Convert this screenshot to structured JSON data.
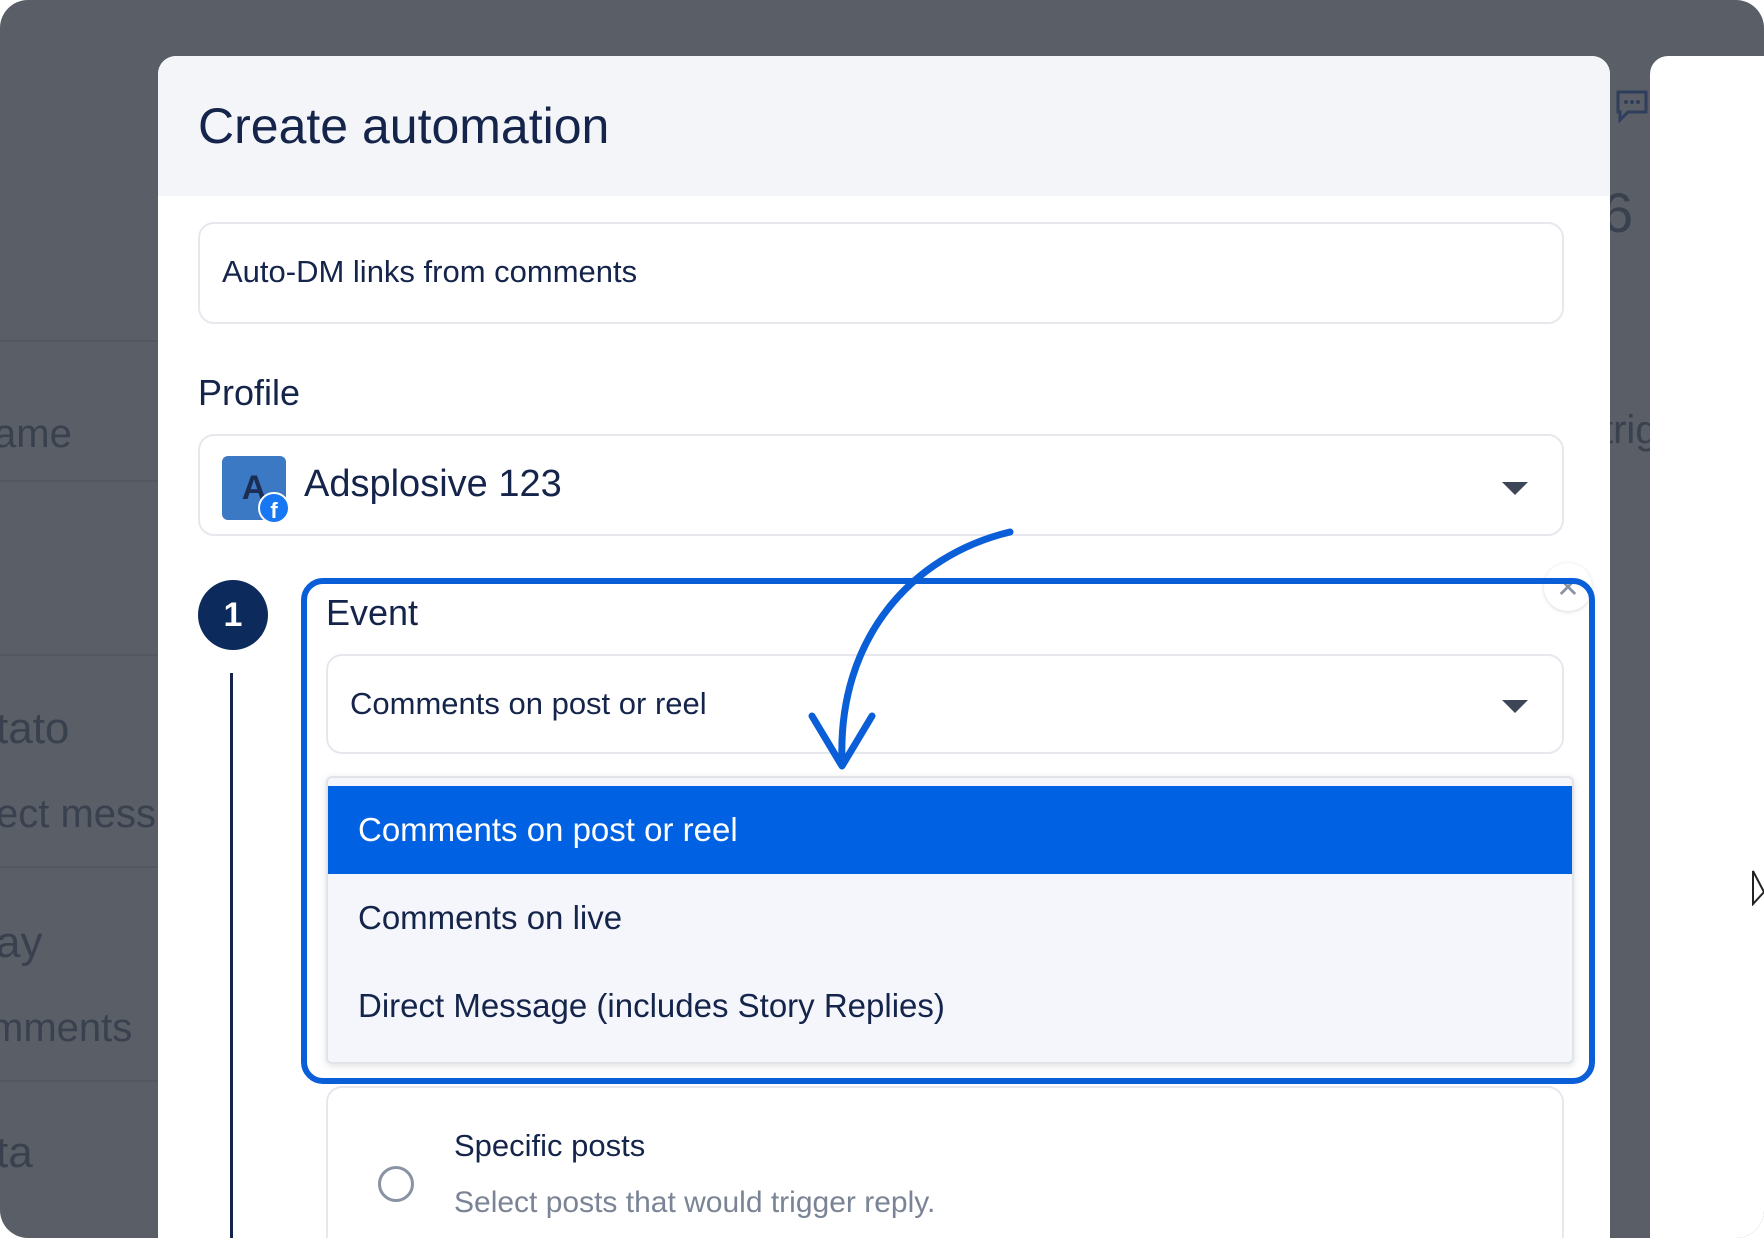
{
  "background": {
    "fragments": [
      "ame",
      "tato",
      "ect mess",
      "ay",
      "mments",
      "ta"
    ],
    "right_fragments": [
      "6",
      "trig"
    ]
  },
  "modal": {
    "title": "Create automation",
    "name_field": {
      "value": "Auto-DM links from comments"
    },
    "profile": {
      "label": "Profile",
      "value": "Adsplosive 123",
      "avatar_letter": "A",
      "badge_letter": "f"
    },
    "step": {
      "number": "1",
      "event": {
        "label": "Event",
        "selected": "Comments on post or reel",
        "options": [
          "Comments on post or reel",
          "Comments on live",
          "Direct Message (includes Story Replies)"
        ]
      }
    },
    "posts_option": {
      "title": "Specific posts",
      "description": "Select posts that would trigger reply."
    },
    "close_symbol": "✕"
  },
  "colors": {
    "accent": "#0062e3",
    "annotation": "#0a5ed7",
    "text": "#14244a",
    "overlay": "#5a5e66"
  }
}
